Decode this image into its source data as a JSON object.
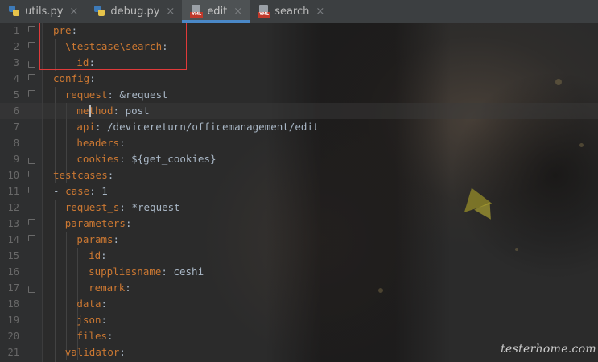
{
  "tabs": [
    {
      "label": "utils.py",
      "icon": "python-file-icon",
      "active": false
    },
    {
      "label": "debug.py",
      "icon": "python-file-icon",
      "active": false
    },
    {
      "label": "edit",
      "icon": "yaml-file-icon",
      "active": true
    },
    {
      "label": "search",
      "icon": "yaml-file-icon",
      "active": false
    }
  ],
  "tab_close_glyph": "×",
  "yml_badge": "YML",
  "editor": {
    "current_line": 6,
    "lines": [
      {
        "n": "1",
        "key": "pre",
        "sep": ":",
        "val": ""
      },
      {
        "n": "2",
        "key": "\\testcase\\search",
        "sep": ":",
        "val": ""
      },
      {
        "n": "3",
        "key": "id",
        "sep": ":",
        "val": ""
      },
      {
        "n": "4",
        "key": "config",
        "sep": ":",
        "val": ""
      },
      {
        "n": "5",
        "key": "request",
        "sep": ":",
        "val": " &request"
      },
      {
        "n": "6",
        "key": "method",
        "sep": ":",
        "val": " post"
      },
      {
        "n": "7",
        "key": "api",
        "sep": ":",
        "val": " /devicereturn/officemanagement/edit"
      },
      {
        "n": "8",
        "key": "headers",
        "sep": ":",
        "val": ""
      },
      {
        "n": "9",
        "key": "cookies",
        "sep": ":",
        "val": " ${get_cookies}"
      },
      {
        "n": "10",
        "key": "testcases",
        "sep": ":",
        "val": ""
      },
      {
        "n": "11",
        "key": "case",
        "sep": ":",
        "val": " 1"
      },
      {
        "n": "12",
        "key": "request_s",
        "sep": ":",
        "val": " *request"
      },
      {
        "n": "13",
        "key": "parameters",
        "sep": ":",
        "val": ""
      },
      {
        "n": "14",
        "key": "params",
        "sep": ":",
        "val": ""
      },
      {
        "n": "15",
        "key": "id",
        "sep": ":",
        "val": ""
      },
      {
        "n": "16",
        "key": "suppliesname",
        "sep": ":",
        "val": " ceshi"
      },
      {
        "n": "17",
        "key": "remark",
        "sep": ":",
        "val": ""
      },
      {
        "n": "18",
        "key": "data",
        "sep": ":",
        "val": ""
      },
      {
        "n": "19",
        "key": "json",
        "sep": ":",
        "val": ""
      },
      {
        "n": "20",
        "key": "files",
        "sep": ":",
        "val": ""
      },
      {
        "n": "21",
        "key": "validator",
        "sep": ":",
        "val": ""
      }
    ],
    "list_dash": "-"
  },
  "watermark": "testerhome.com",
  "colors": {
    "key": "#cc7832",
    "value": "#a9b7c6",
    "highlight_box": "#e03a3a",
    "active_tab_underline": "#4a88c7"
  }
}
